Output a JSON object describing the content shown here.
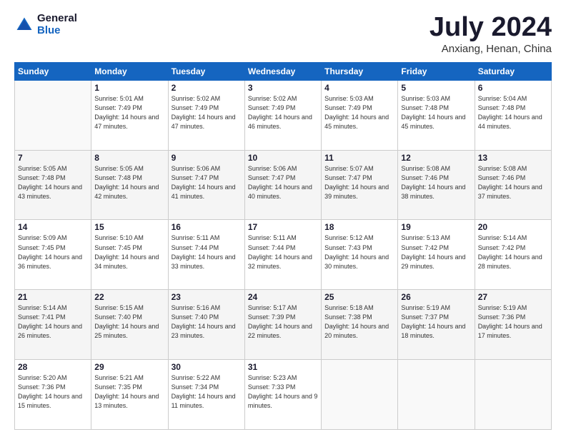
{
  "header": {
    "logo_general": "General",
    "logo_blue": "Blue",
    "month_title": "July 2024",
    "location": "Anxiang, Henan, China"
  },
  "days_of_week": [
    "Sunday",
    "Monday",
    "Tuesday",
    "Wednesday",
    "Thursday",
    "Friday",
    "Saturday"
  ],
  "weeks": [
    [
      {
        "day": "",
        "sunrise": "",
        "sunset": "",
        "daylight": ""
      },
      {
        "day": "1",
        "sunrise": "Sunrise: 5:01 AM",
        "sunset": "Sunset: 7:49 PM",
        "daylight": "Daylight: 14 hours and 47 minutes."
      },
      {
        "day": "2",
        "sunrise": "Sunrise: 5:02 AM",
        "sunset": "Sunset: 7:49 PM",
        "daylight": "Daylight: 14 hours and 47 minutes."
      },
      {
        "day": "3",
        "sunrise": "Sunrise: 5:02 AM",
        "sunset": "Sunset: 7:49 PM",
        "daylight": "Daylight: 14 hours and 46 minutes."
      },
      {
        "day": "4",
        "sunrise": "Sunrise: 5:03 AM",
        "sunset": "Sunset: 7:49 PM",
        "daylight": "Daylight: 14 hours and 45 minutes."
      },
      {
        "day": "5",
        "sunrise": "Sunrise: 5:03 AM",
        "sunset": "Sunset: 7:48 PM",
        "daylight": "Daylight: 14 hours and 45 minutes."
      },
      {
        "day": "6",
        "sunrise": "Sunrise: 5:04 AM",
        "sunset": "Sunset: 7:48 PM",
        "daylight": "Daylight: 14 hours and 44 minutes."
      }
    ],
    [
      {
        "day": "7",
        "sunrise": "Sunrise: 5:05 AM",
        "sunset": "Sunset: 7:48 PM",
        "daylight": "Daylight: 14 hours and 43 minutes."
      },
      {
        "day": "8",
        "sunrise": "Sunrise: 5:05 AM",
        "sunset": "Sunset: 7:48 PM",
        "daylight": "Daylight: 14 hours and 42 minutes."
      },
      {
        "day": "9",
        "sunrise": "Sunrise: 5:06 AM",
        "sunset": "Sunset: 7:47 PM",
        "daylight": "Daylight: 14 hours and 41 minutes."
      },
      {
        "day": "10",
        "sunrise": "Sunrise: 5:06 AM",
        "sunset": "Sunset: 7:47 PM",
        "daylight": "Daylight: 14 hours and 40 minutes."
      },
      {
        "day": "11",
        "sunrise": "Sunrise: 5:07 AM",
        "sunset": "Sunset: 7:47 PM",
        "daylight": "Daylight: 14 hours and 39 minutes."
      },
      {
        "day": "12",
        "sunrise": "Sunrise: 5:08 AM",
        "sunset": "Sunset: 7:46 PM",
        "daylight": "Daylight: 14 hours and 38 minutes."
      },
      {
        "day": "13",
        "sunrise": "Sunrise: 5:08 AM",
        "sunset": "Sunset: 7:46 PM",
        "daylight": "Daylight: 14 hours and 37 minutes."
      }
    ],
    [
      {
        "day": "14",
        "sunrise": "Sunrise: 5:09 AM",
        "sunset": "Sunset: 7:45 PM",
        "daylight": "Daylight: 14 hours and 36 minutes."
      },
      {
        "day": "15",
        "sunrise": "Sunrise: 5:10 AM",
        "sunset": "Sunset: 7:45 PM",
        "daylight": "Daylight: 14 hours and 34 minutes."
      },
      {
        "day": "16",
        "sunrise": "Sunrise: 5:11 AM",
        "sunset": "Sunset: 7:44 PM",
        "daylight": "Daylight: 14 hours and 33 minutes."
      },
      {
        "day": "17",
        "sunrise": "Sunrise: 5:11 AM",
        "sunset": "Sunset: 7:44 PM",
        "daylight": "Daylight: 14 hours and 32 minutes."
      },
      {
        "day": "18",
        "sunrise": "Sunrise: 5:12 AM",
        "sunset": "Sunset: 7:43 PM",
        "daylight": "Daylight: 14 hours and 30 minutes."
      },
      {
        "day": "19",
        "sunrise": "Sunrise: 5:13 AM",
        "sunset": "Sunset: 7:42 PM",
        "daylight": "Daylight: 14 hours and 29 minutes."
      },
      {
        "day": "20",
        "sunrise": "Sunrise: 5:14 AM",
        "sunset": "Sunset: 7:42 PM",
        "daylight": "Daylight: 14 hours and 28 minutes."
      }
    ],
    [
      {
        "day": "21",
        "sunrise": "Sunrise: 5:14 AM",
        "sunset": "Sunset: 7:41 PM",
        "daylight": "Daylight: 14 hours and 26 minutes."
      },
      {
        "day": "22",
        "sunrise": "Sunrise: 5:15 AM",
        "sunset": "Sunset: 7:40 PM",
        "daylight": "Daylight: 14 hours and 25 minutes."
      },
      {
        "day": "23",
        "sunrise": "Sunrise: 5:16 AM",
        "sunset": "Sunset: 7:40 PM",
        "daylight": "Daylight: 14 hours and 23 minutes."
      },
      {
        "day": "24",
        "sunrise": "Sunrise: 5:17 AM",
        "sunset": "Sunset: 7:39 PM",
        "daylight": "Daylight: 14 hours and 22 minutes."
      },
      {
        "day": "25",
        "sunrise": "Sunrise: 5:18 AM",
        "sunset": "Sunset: 7:38 PM",
        "daylight": "Daylight: 14 hours and 20 minutes."
      },
      {
        "day": "26",
        "sunrise": "Sunrise: 5:19 AM",
        "sunset": "Sunset: 7:37 PM",
        "daylight": "Daylight: 14 hours and 18 minutes."
      },
      {
        "day": "27",
        "sunrise": "Sunrise: 5:19 AM",
        "sunset": "Sunset: 7:36 PM",
        "daylight": "Daylight: 14 hours and 17 minutes."
      }
    ],
    [
      {
        "day": "28",
        "sunrise": "Sunrise: 5:20 AM",
        "sunset": "Sunset: 7:36 PM",
        "daylight": "Daylight: 14 hours and 15 minutes."
      },
      {
        "day": "29",
        "sunrise": "Sunrise: 5:21 AM",
        "sunset": "Sunset: 7:35 PM",
        "daylight": "Daylight: 14 hours and 13 minutes."
      },
      {
        "day": "30",
        "sunrise": "Sunrise: 5:22 AM",
        "sunset": "Sunset: 7:34 PM",
        "daylight": "Daylight: 14 hours and 11 minutes."
      },
      {
        "day": "31",
        "sunrise": "Sunrise: 5:23 AM",
        "sunset": "Sunset: 7:33 PM",
        "daylight": "Daylight: 14 hours and 9 minutes."
      },
      {
        "day": "",
        "sunrise": "",
        "sunset": "",
        "daylight": ""
      },
      {
        "day": "",
        "sunrise": "",
        "sunset": "",
        "daylight": ""
      },
      {
        "day": "",
        "sunrise": "",
        "sunset": "",
        "daylight": ""
      }
    ]
  ]
}
